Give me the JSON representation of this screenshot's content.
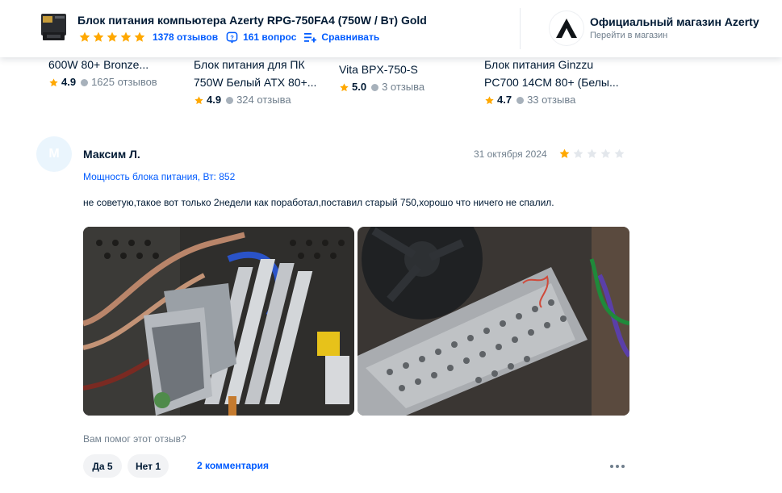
{
  "header": {
    "product_title": "Блок питания компьютера Azerty RPG-750FA4 (750W / Вт) Gold",
    "rating_stars": 5,
    "reviews_link": "1378 отзывов",
    "questions_link": "161 вопрос",
    "compare_link": "Сравнивать",
    "shop_name": "Официальный магазин Azerty",
    "shop_link": "Перейти в магазин",
    "star_color": "#ffa800",
    "link_color": "#005bff"
  },
  "similar": [
    {
      "line1": "600W 80+ Bronze...",
      "line2": "",
      "rating": "4.9",
      "count": "1625 отзывов"
    },
    {
      "line1": "Блок питания для ПК",
      "line2": "750W Белый ATX 80+...",
      "rating": "4.9",
      "count": "324 отзыва"
    },
    {
      "line1": "Vita BPX-750-S",
      "line2": "",
      "rating": "5.0",
      "count": "3 отзыва"
    },
    {
      "line1": "Блок питания Ginzzu",
      "line2": "PC700 14CM 80+ (Белы...",
      "rating": "4.7",
      "count": "33 отзыва"
    }
  ],
  "review": {
    "avatar_letter": "М",
    "author": "Максим Л.",
    "date": "31 октября 2024",
    "rating": 1,
    "variant": "Мощность блока питания, Вт: 852",
    "text": "не советую,такое вот только 2недели как поработал,поставил старый 750,хорошо что ничего не спалил.",
    "helpful_question": "Вам помог этот отзыв?",
    "yes_label": "Да 5",
    "no_label": "Нет 1",
    "comments_link": "2 комментария"
  }
}
